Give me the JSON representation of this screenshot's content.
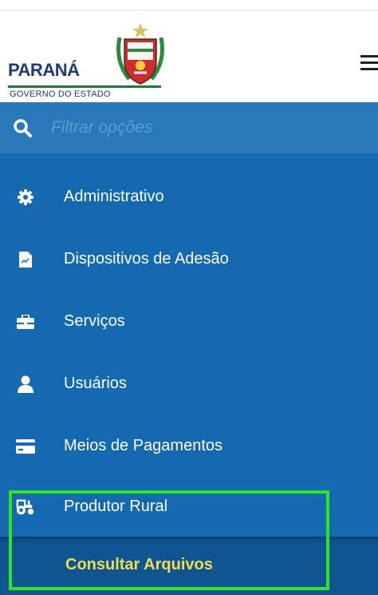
{
  "header": {
    "logo_word": "PARANÁ",
    "logo_subtitle": "GOVERNO DO ESTADO"
  },
  "filter": {
    "placeholder": "Filtrar opções",
    "icon": "search-icon"
  },
  "menu": {
    "items": [
      {
        "label": "Administrativo",
        "icon": "gear-icon"
      },
      {
        "label": "Dispositivos de Adesão",
        "icon": "document-icon"
      },
      {
        "label": "Serviços",
        "icon": "toolbox-icon"
      },
      {
        "label": "Usuários",
        "icon": "user-icon"
      },
      {
        "label": "Meios de Pagamentos",
        "icon": "credit-card-icon"
      },
      {
        "label": "Produtor Rural",
        "icon": "tractor-icon"
      }
    ],
    "submenu": {
      "label": "Consultar Arquivos"
    }
  },
  "colors": {
    "sidebar_bg": "#1469b0",
    "filter_bg": "#2b78ba",
    "submenu_bg": "#0e5592",
    "submenu_text": "#f2dd4a",
    "highlight": "#2ee51e"
  }
}
